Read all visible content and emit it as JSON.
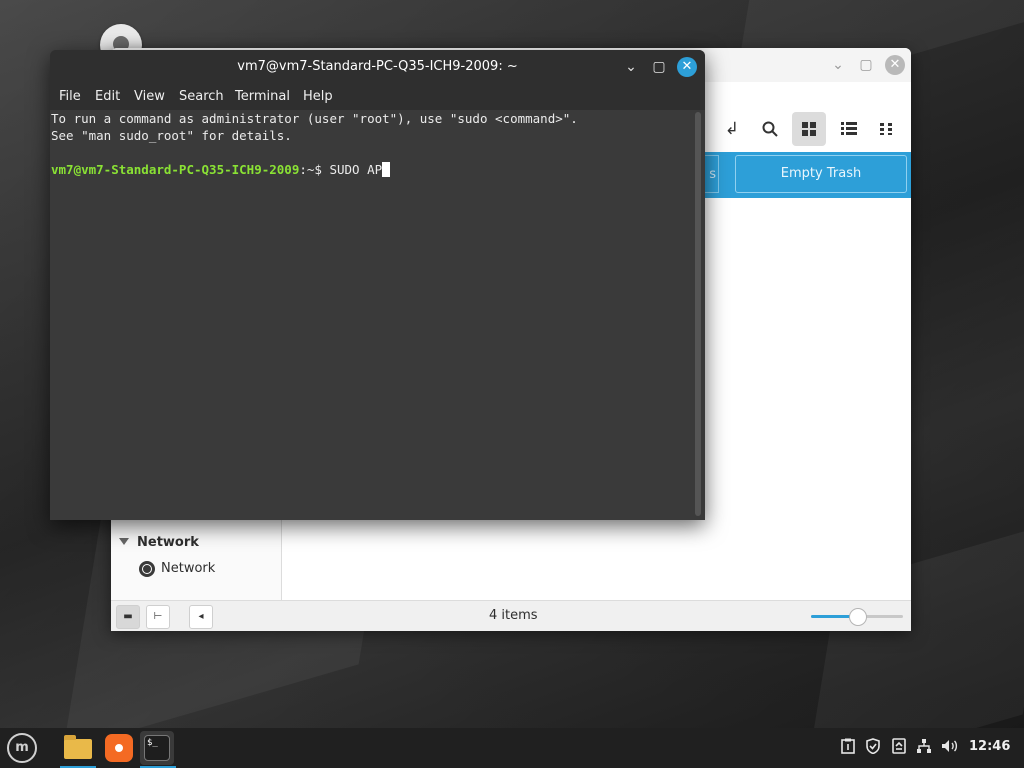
{
  "terminal": {
    "title": "vm7@vm7-Standard-PC-Q35-ICH9-2009: ~",
    "minimize": "⌄",
    "maximize": "▢",
    "close": "✕",
    "menu": [
      "File",
      "Edit",
      "View",
      "Search",
      "Terminal",
      "Help"
    ],
    "lines": [
      "To run a command as administrator (user \"root\"), use \"sudo <command>\".",
      "See \"man sudo_root\" for details."
    ],
    "prompt_user": "vm7@vm7-Standard-PC-Q35-ICH9-2009",
    "prompt_sep": ":~$ ",
    "command": "SUDO AP"
  },
  "file_manager": {
    "minimize": "⌄",
    "maximize": "▢",
    "close": "✕",
    "trash_partial": "s",
    "empty_trash": "Empty Trash",
    "sidebar": {
      "section": "Network",
      "item": "Network"
    },
    "status": {
      "items": "4 items",
      "zoom_level": 0.5
    },
    "toolbar_icons": [
      "return-arrow-icon",
      "search-icon",
      "grid-view-icon",
      "list-view-icon",
      "compact-view-icon"
    ]
  },
  "taskbar": {
    "menu_glyph": "m",
    "apps": [
      "files",
      "firefox",
      "terminal"
    ],
    "tray_icons": [
      "clipboard-icon",
      "shield-icon",
      "update-icon",
      "network-icon",
      "volume-icon"
    ],
    "clock": "12:46"
  },
  "colors": {
    "accent": "#2d9fd8",
    "prompt": "#8ae234"
  }
}
